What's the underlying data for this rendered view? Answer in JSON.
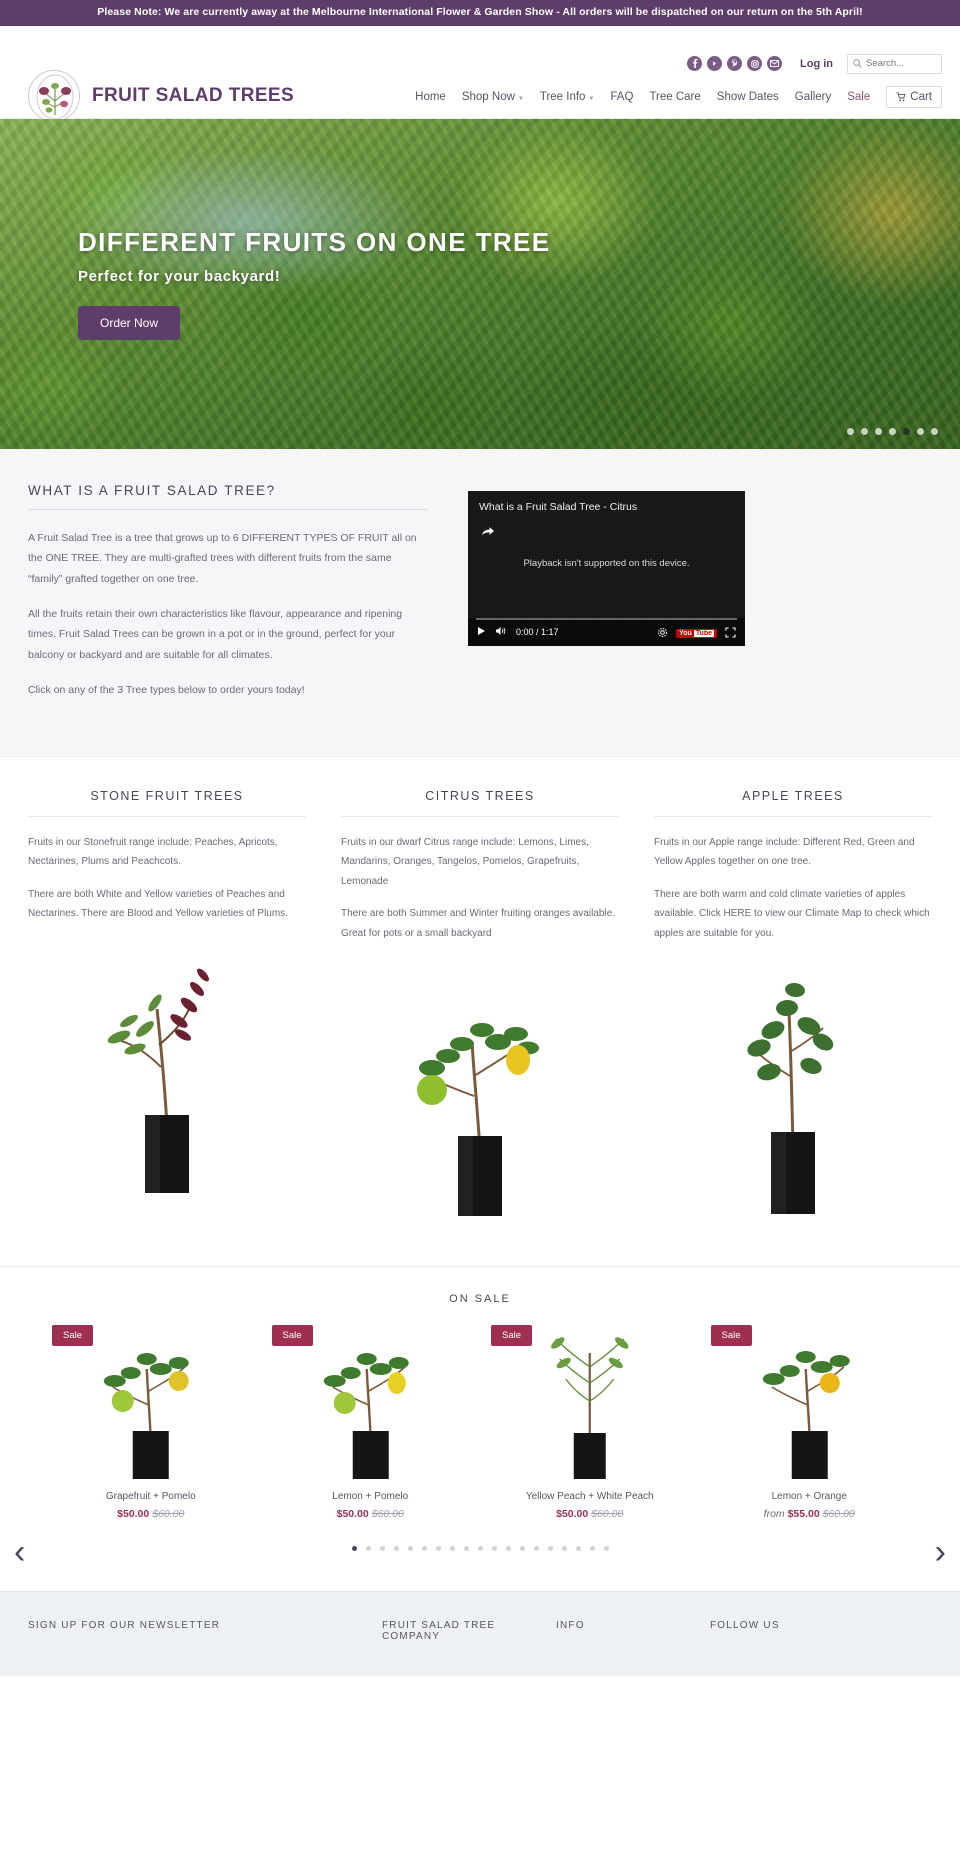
{
  "announcement": "Please Note: We are currently away at the Melbourne International Flower & Garden Show - All orders will be dispatched on our return on the 5th April!",
  "colors": {
    "brand_purple": "#5f3d6b",
    "sale_crimson": "#9e2f51",
    "announce_bg": "#5f3d6b"
  },
  "header": {
    "brand_name": "FRUIT SALAD TREES",
    "login_label": "Log in",
    "search_placeholder": "Search...",
    "social": [
      {
        "name": "facebook-icon",
        "glyph": "f"
      },
      {
        "name": "youtube-icon",
        "glyph": "▶"
      },
      {
        "name": "pinterest-icon",
        "glyph": "P"
      },
      {
        "name": "instagram-icon",
        "glyph": "◎"
      },
      {
        "name": "email-icon",
        "glyph": "✉"
      }
    ],
    "nav": [
      {
        "label": "Home",
        "dropdown": false,
        "accent": false
      },
      {
        "label": "Shop Now",
        "dropdown": true,
        "accent": false
      },
      {
        "label": "Tree Info",
        "dropdown": true,
        "accent": false
      },
      {
        "label": "FAQ",
        "dropdown": false,
        "accent": false
      },
      {
        "label": "Tree Care",
        "dropdown": false,
        "accent": false
      },
      {
        "label": "Show Dates",
        "dropdown": false,
        "accent": false
      },
      {
        "label": "Gallery",
        "dropdown": false,
        "accent": false
      },
      {
        "label": "Sale",
        "dropdown": false,
        "accent": true
      }
    ],
    "cart_label": "Cart"
  },
  "hero": {
    "title": "DIFFERENT FRUITS ON ONE TREE",
    "subtitle": "Perfect for your backyard!",
    "button_label": "Order Now",
    "dots_count": 7,
    "active_dot": 4
  },
  "whatis": {
    "title": "WHAT IS A FRUIT SALAD TREE?",
    "paragraphs": [
      "A Fruit Salad Tree is a tree that grows up to 6 DIFFERENT TYPES OF FRUIT all on the ONE TREE.  They are multi-grafted trees with different fruits from the same “family” grafted together on one tree.",
      "All the fruits retain their own characteristics like flavour, appearance and ripening times.  Fruit Salad Trees can be grown in a pot or in the ground, perfect for your balcony or backyard and are suitable for all climates.",
      "Click on any of the 3 Tree types below to order yours today!"
    ],
    "video": {
      "title": "What is a Fruit Salad Tree - Citrus",
      "message": "Playback isn't supported on this device.",
      "time": "0:00 / 1:17",
      "youtube_label": "You",
      "youtube_label2": "Tube"
    }
  },
  "tree_columns": [
    {
      "heading": "STONE FRUIT TREES",
      "paragraphs": [
        "Fruits in our Stonefruit range include: Peaches, Apricots, Nectarines, Plums and Peachcots.",
        "There are both White and Yellow varieties of Peaches and Nectarines. There are Blood and Yellow varieties of Plums."
      ],
      "photo_name": "stone-fruit-tree-photo"
    },
    {
      "heading": "CITRUS TREES",
      "paragraphs": [
        "Fruits in our dwarf Citrus range include: Lemons, Limes, Mandarins, Oranges, Tangelos, Pomelos, Grapefruits, Lemonade",
        "There are both Summer and Winter fruiting oranges available.  Great for pots or a small backyard"
      ],
      "photo_name": "citrus-tree-photo"
    },
    {
      "heading": "APPLE TREES",
      "paragraphs": [
        "Fruits in our Apple range include:   Different Red, Green and Yellow Apples together on one tree.",
        "There are both warm and cold climate varieties of apples available.  Click HERE to view our Climate Map to check which apples are suitable for you."
      ],
      "photo_name": "apple-tree-photo"
    }
  ],
  "on_sale": {
    "heading": "ON SALE",
    "badge_label": "Sale",
    "prev_arrow": "‹",
    "next_arrow": "›",
    "products": [
      {
        "name": "Grapefruit + Pomelo",
        "price": "$50.00",
        "compare_at": "$60.00",
        "from_prefix": ""
      },
      {
        "name": "Lemon + Pomelo",
        "price": "$50.00",
        "compare_at": "$60.00",
        "from_prefix": ""
      },
      {
        "name": "Yellow Peach + White Peach",
        "price": "$50.00",
        "compare_at": "$60.00",
        "from_prefix": ""
      },
      {
        "name": "Lemon + Orange",
        "price": "$55.00",
        "compare_at": "$60.00",
        "from_prefix": "from"
      }
    ],
    "dots_count": 19,
    "active_dot": 0
  },
  "footer": {
    "newsletter_heading": "SIGN UP FOR OUR NEWSLETTER",
    "company_heading": "FRUIT SALAD TREE COMPANY",
    "info_heading": "INFO",
    "follow_heading": "FOLLOW US"
  }
}
